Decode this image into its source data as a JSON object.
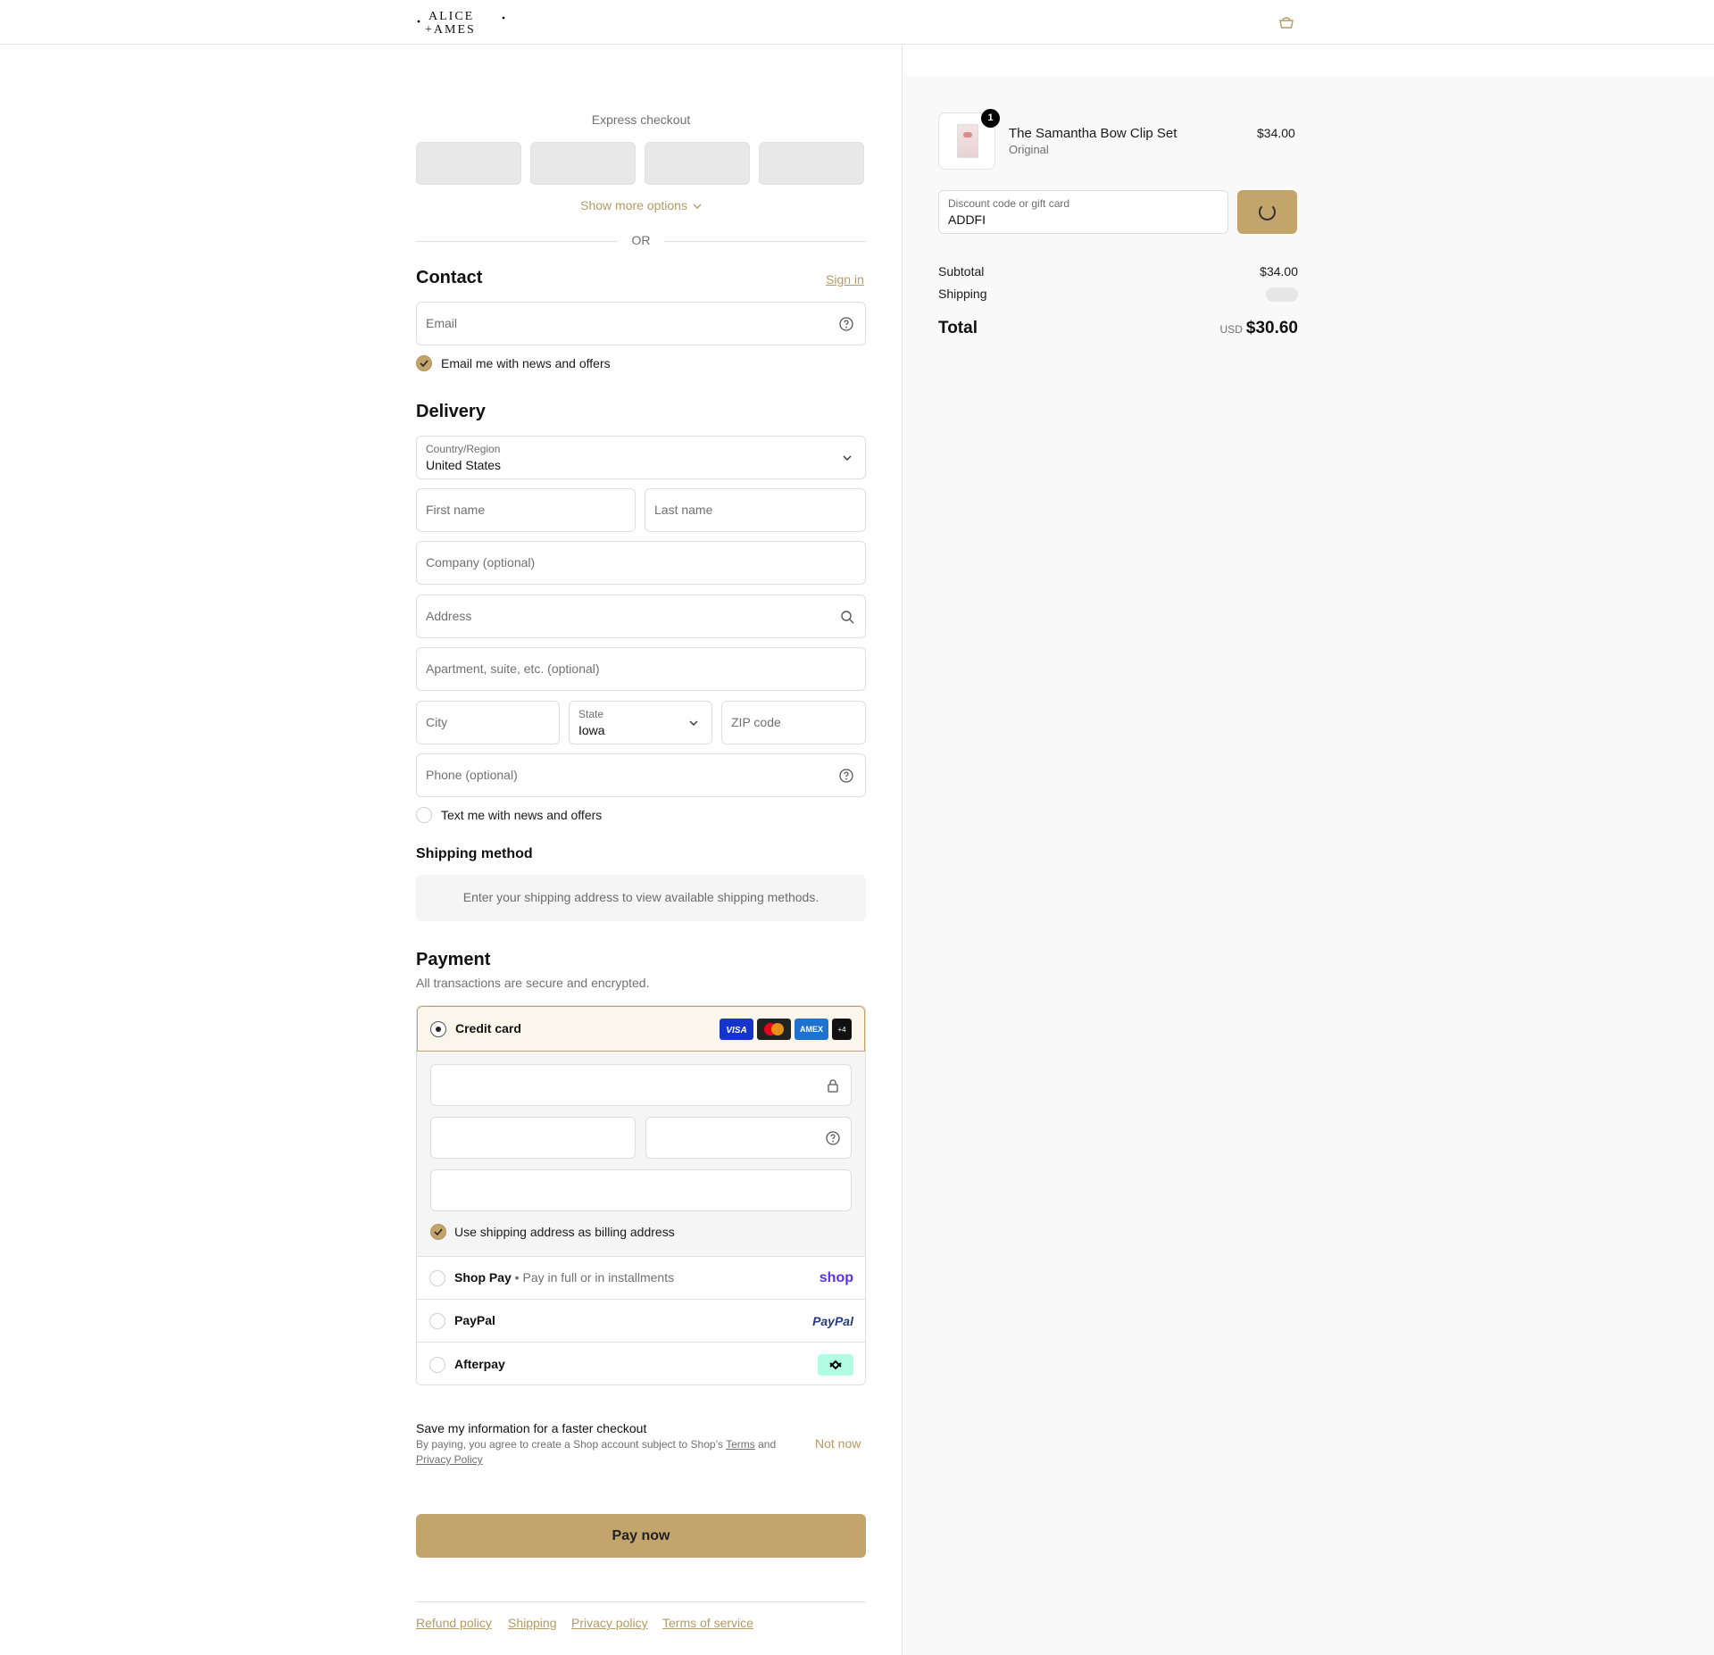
{
  "brand": {
    "logo_line1": "ALICE",
    "logo_line2": "AMES"
  },
  "express": {
    "title": "Express checkout",
    "show_more": "Show more options",
    "or": "OR"
  },
  "contact": {
    "heading": "Contact",
    "sign_in": "Sign in",
    "email_placeholder": "Email",
    "newsletter_label": "Email me with news and offers",
    "newsletter_checked": true
  },
  "delivery": {
    "heading": "Delivery",
    "country_label": "Country/Region",
    "country_value": "United States",
    "first_name_placeholder": "First name",
    "last_name_placeholder": "Last name",
    "company_placeholder": "Company (optional)",
    "address_placeholder": "Address",
    "apartment_placeholder": "Apartment, suite, etc. (optional)",
    "city_placeholder": "City",
    "state_label": "State",
    "state_value": "Iowa",
    "zip_placeholder": "ZIP code",
    "phone_placeholder": "Phone (optional)",
    "sms_label": "Text me with news and offers",
    "sms_checked": false
  },
  "shipping_method": {
    "heading": "Shipping method",
    "message": "Enter your shipping address to view available shipping methods."
  },
  "payment": {
    "heading": "Payment",
    "subtitle": "All transactions are secure and encrypted.",
    "credit_card_label": "Credit card",
    "card_brands": [
      "VISA",
      "Mastercard",
      "AMEX",
      "+4"
    ],
    "billing_same_label": "Use shipping address as billing address",
    "billing_same_checked": true,
    "methods": [
      {
        "label": "Shop Pay",
        "desc": " • Pay in full or in installments",
        "brand": "shop"
      },
      {
        "label": "PayPal",
        "desc": "",
        "brand": "PayPal"
      },
      {
        "label": "Afterpay",
        "desc": "",
        "brand": "afterpay-icon"
      }
    ]
  },
  "save_info": {
    "title": "Save my information for a faster checkout",
    "legal_prefix": "By paying, you agree to create a Shop account subject to Shop’s ",
    "terms_link": "Terms",
    "legal_and": " and ",
    "privacy_link": "Privacy Policy",
    "not_now": "Not now"
  },
  "pay_now": "Pay now",
  "footer_links": [
    "Refund policy",
    "Shipping",
    "Privacy policy",
    "Terms of service"
  ],
  "summary": {
    "item": {
      "quantity": "1",
      "name": "The Samantha Bow Clip Set",
      "variant": "Original",
      "price": "$34.00"
    },
    "discount_label": "Discount code or gift card",
    "discount_value": "ADDFI",
    "subtotal_label": "Subtotal",
    "subtotal_value": "$34.00",
    "shipping_label": "Shipping",
    "total_label": "Total",
    "total_currency": "USD",
    "total_value": "$30.60"
  },
  "colors": {
    "accent": "#c3a56c",
    "accent_text": "#b49a63",
    "summary_bg": "#f9f9f9"
  }
}
